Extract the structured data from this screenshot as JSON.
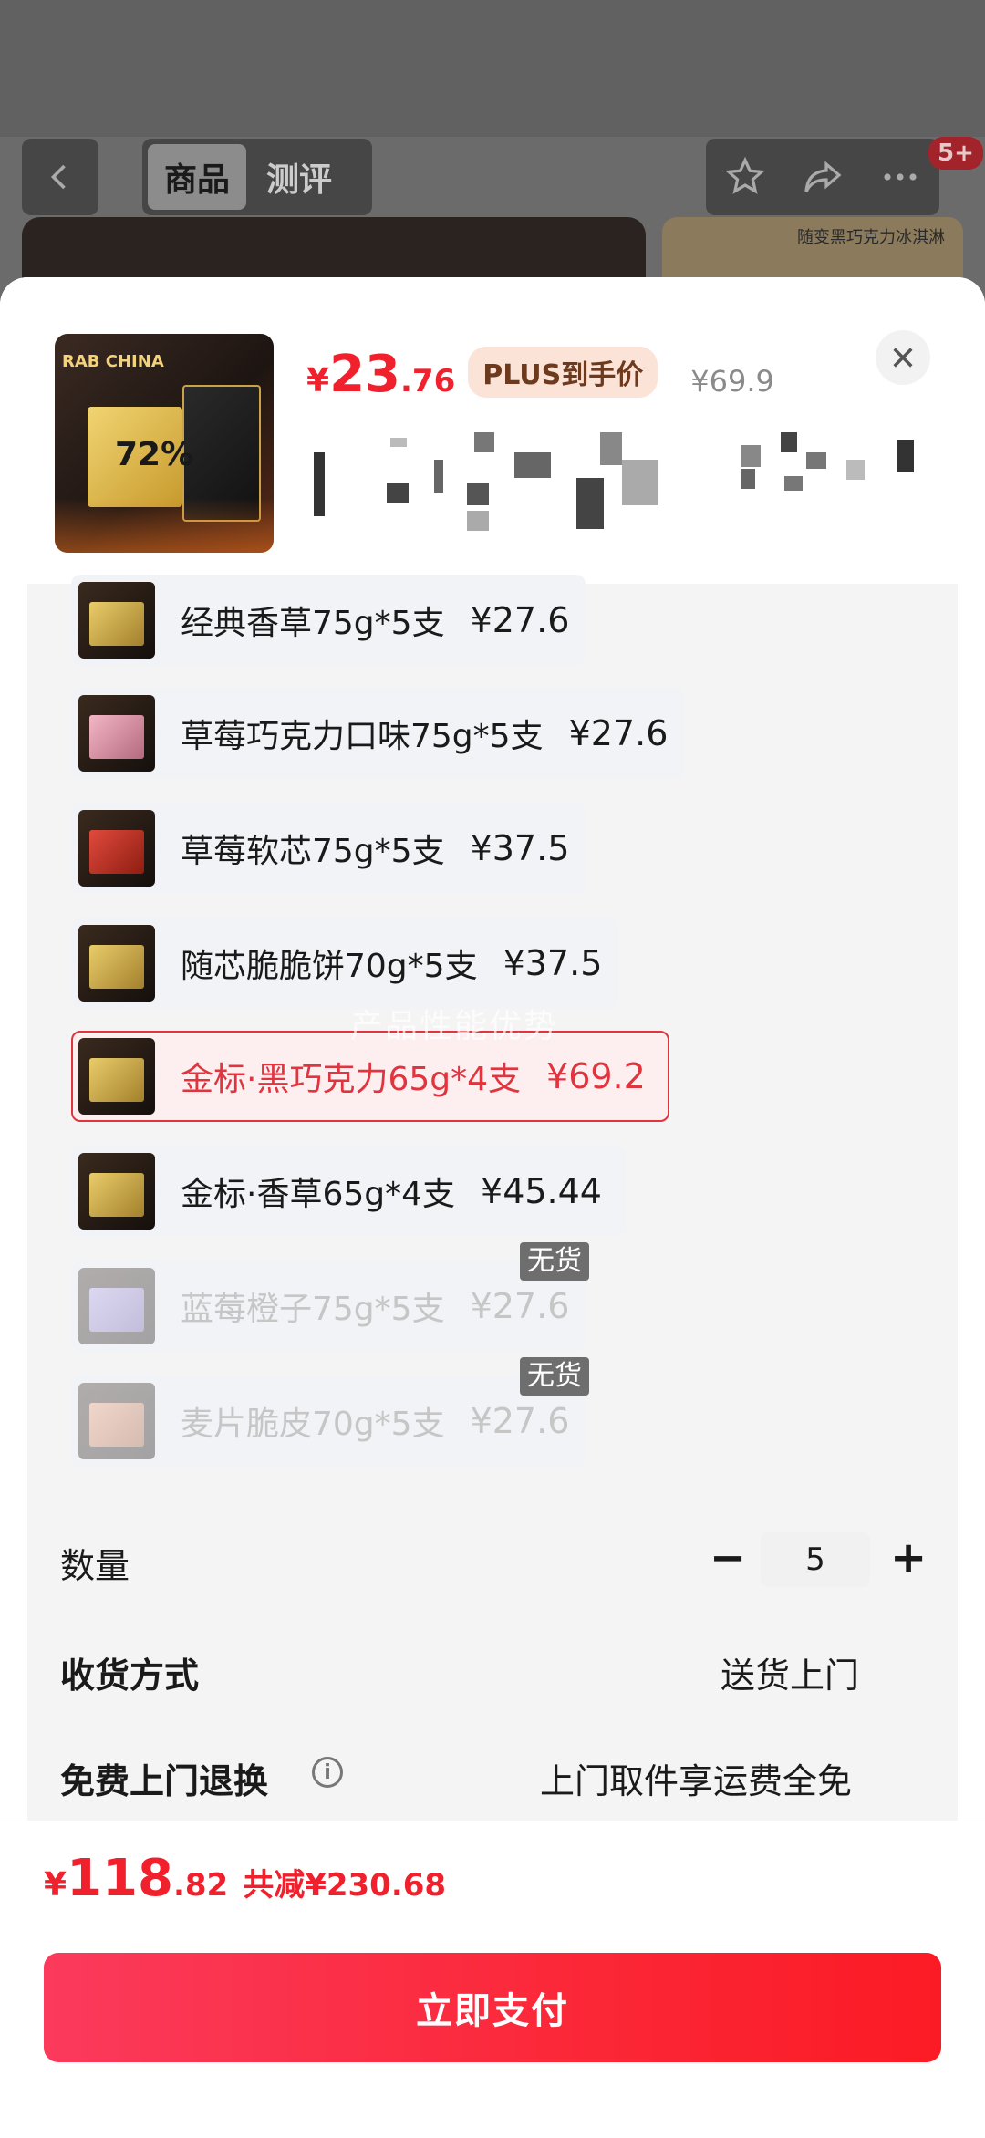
{
  "background": {
    "tabs": [
      "商品",
      "测评"
    ],
    "active_tab": "商品",
    "cart_badge": "5+",
    "banner_text": "随变黑巧克力冰淇淋"
  },
  "product": {
    "price_symbol": "¥",
    "price_int": "23",
    "price_dec": ".76",
    "plus_label": "PLUS到手价",
    "original_price": "¥69.9"
  },
  "options": [
    {
      "label": "经典香草75g*5支",
      "price": "¥27.6",
      "state": "normal"
    },
    {
      "label": "草莓巧克力口味75g*5支",
      "price": "¥27.6",
      "state": "normal"
    },
    {
      "label": "草莓软芯75g*5支",
      "price": "¥37.5",
      "state": "normal"
    },
    {
      "label": "随芯脆脆饼70g*5支",
      "price": "¥37.5",
      "state": "normal"
    },
    {
      "label": "金标·黑巧克力65g*4支",
      "price": "¥69.2",
      "state": "selected"
    },
    {
      "label": "金标·香草65g*4支",
      "price": "¥45.44",
      "state": "normal"
    },
    {
      "label": "蓝莓橙子75g*5支",
      "price": "¥27.6",
      "state": "disabled"
    },
    {
      "label": "麦片脆皮70g*5支",
      "price": "¥27.6",
      "state": "disabled"
    }
  ],
  "soldout_label": "无货",
  "watermark": "产品性能优势",
  "quantity": {
    "label": "数量",
    "value": "5",
    "minus": "−",
    "plus": "+"
  },
  "delivery": {
    "label": "收货方式",
    "value": "送货上门"
  },
  "return_service": {
    "label": "免费上门退换",
    "value": "上门取件享运费全免"
  },
  "footer": {
    "total_symbol": "¥",
    "total_int": "118",
    "total_dec": ".82",
    "saved_text": "共减¥230.68",
    "pay_label": "立即支付"
  }
}
